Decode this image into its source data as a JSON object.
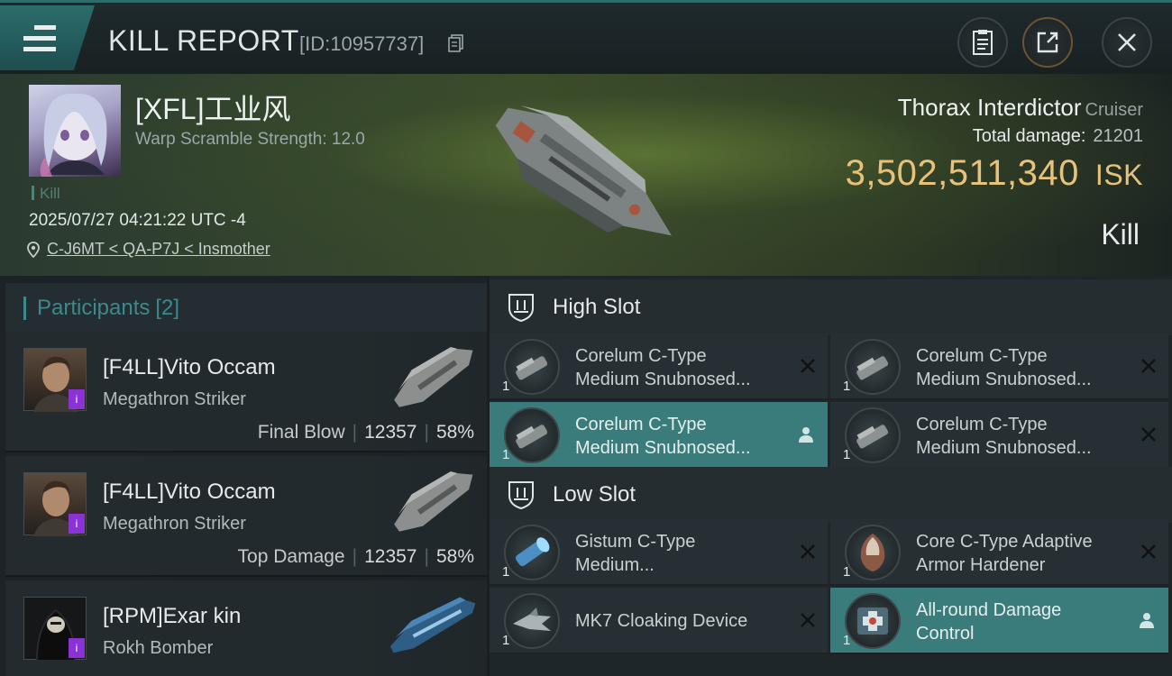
{
  "header": {
    "title": "KILL REPORT",
    "report_id": "[ID:10957737]"
  },
  "victim": {
    "name": "[XFL]工业风",
    "warp_scramble": "Warp Scramble Strength: 12.0",
    "tag": "Kill",
    "timestamp": "2025/07/27 04:21:22 UTC -4",
    "location": "C-J6MT < QA-P7J < Insmother",
    "ship_name": "Thorax Interdictor",
    "ship_class": "Cruiser",
    "total_damage_label": "Total damage:",
    "total_damage": "21201",
    "isk_value": "3,502,511,340",
    "isk_unit": "ISK",
    "result": "Kill"
  },
  "participants": {
    "label": "Participants",
    "count": "[2]",
    "rows": [
      {
        "name": "[F4LL]Vito Occam",
        "ship": "Megathron Striker",
        "role": "Final Blow",
        "damage": "12357",
        "percent": "58%"
      },
      {
        "name": "[F4LL]Vito Occam",
        "ship": "Megathron Striker",
        "role": "Top Damage",
        "damage": "12357",
        "percent": "58%"
      },
      {
        "name": "[RPM]Exar kin",
        "ship": "Rokh Bomber",
        "role": "",
        "damage": "",
        "percent": ""
      }
    ]
  },
  "fitting": {
    "high_slot_label": "High Slot",
    "low_slot_label": "Low Slot",
    "high_items": [
      {
        "qty": "1",
        "line1": "Corelum C-Type",
        "line2": "Medium Snubnosed...",
        "state": "destroyed"
      },
      {
        "qty": "1",
        "line1": "Corelum C-Type",
        "line2": "Medium Snubnosed...",
        "state": "destroyed"
      },
      {
        "qty": "1",
        "line1": "Corelum C-Type",
        "line2": "Medium Snubnosed...",
        "state": "dropped"
      },
      {
        "qty": "1",
        "line1": "Corelum C-Type",
        "line2": "Medium Snubnosed...",
        "state": "destroyed"
      }
    ],
    "low_items": [
      {
        "qty": "1",
        "line1": "Gistum C-Type",
        "line2": "Medium...",
        "state": "destroyed"
      },
      {
        "qty": "1",
        "line1": "Core C-Type Adaptive",
        "line2": "Armor Hardener",
        "state": "destroyed"
      },
      {
        "qty": "1",
        "line1": "MK7 Cloaking Device",
        "line2": "",
        "state": "destroyed"
      },
      {
        "qty": "1",
        "line1": "All-round Damage",
        "line2": "Control",
        "state": "dropped"
      }
    ]
  },
  "colors": {
    "accent_teal": "#3a7c7b",
    "isk_gold": "#e9c27a",
    "corp_badge_purple": "#8a32d4"
  }
}
